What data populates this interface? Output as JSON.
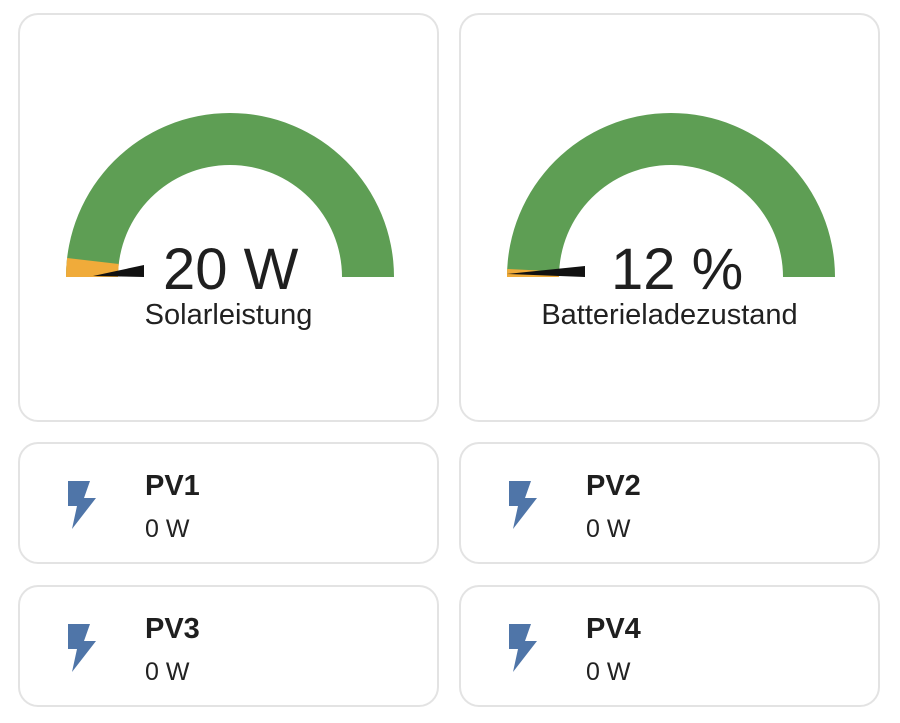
{
  "colors": {
    "gauge_green": "#5e9e54",
    "gauge_orange": "#f0ab3a",
    "needle": "#111111",
    "icon": "#4f75a8"
  },
  "gauges": [
    {
      "label": "Solarleistung",
      "value_text": "20 W",
      "fraction": 0.03
    },
    {
      "label": "Batterieladezustand",
      "value_text": "12 %",
      "fraction": 0.015
    }
  ],
  "entities": [
    {
      "name": "PV1",
      "state": "0 W",
      "icon": "flash-icon"
    },
    {
      "name": "PV2",
      "state": "0 W",
      "icon": "flash-icon"
    },
    {
      "name": "PV3",
      "state": "0 W",
      "icon": "flash-icon"
    },
    {
      "name": "PV4",
      "state": "0 W",
      "icon": "flash-icon"
    }
  ]
}
